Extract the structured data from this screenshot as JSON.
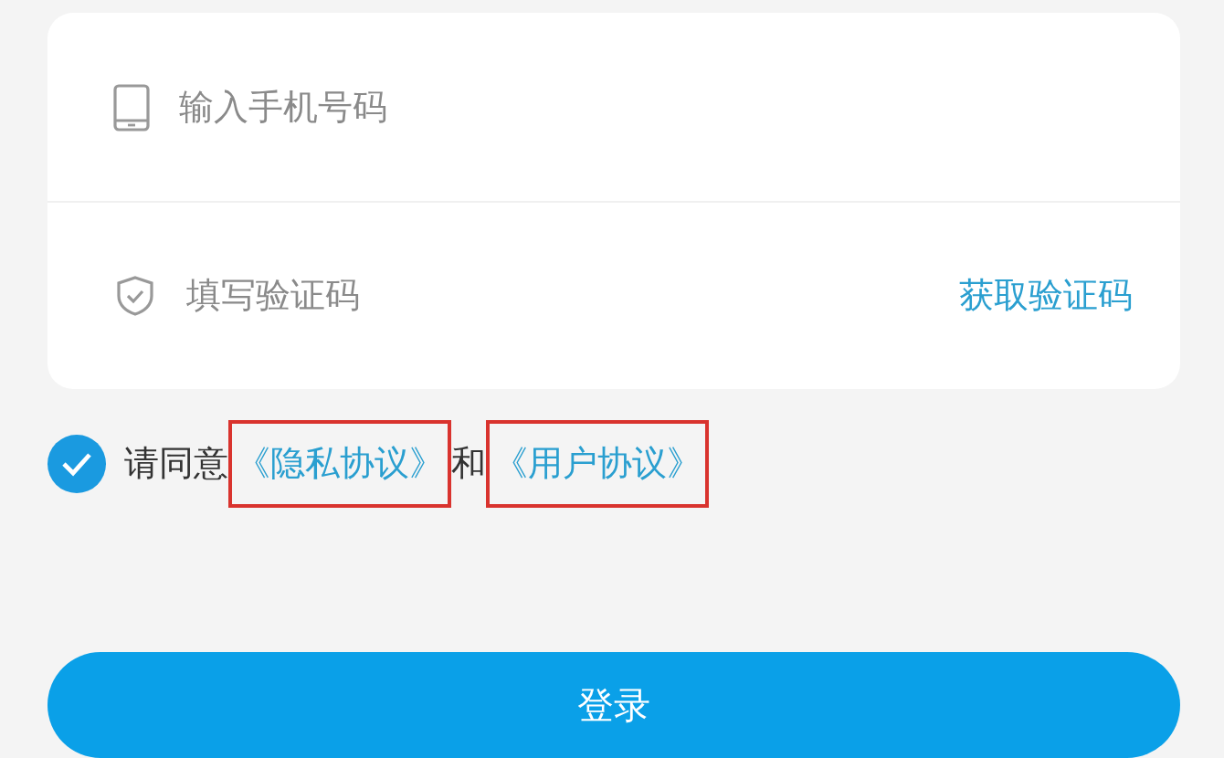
{
  "form": {
    "phone": {
      "placeholder": "输入手机号码"
    },
    "code": {
      "placeholder": "填写验证码",
      "action": "获取验证码"
    }
  },
  "agreement": {
    "checked": true,
    "parts": [
      {
        "kind": "text",
        "text": "请同意"
      },
      {
        "kind": "link",
        "text": "《隐私协议》",
        "highlighted": true
      },
      {
        "kind": "text",
        "text": "和"
      },
      {
        "kind": "link",
        "text": "《用户协议》",
        "highlighted": true
      }
    ]
  },
  "login_button": "登录"
}
